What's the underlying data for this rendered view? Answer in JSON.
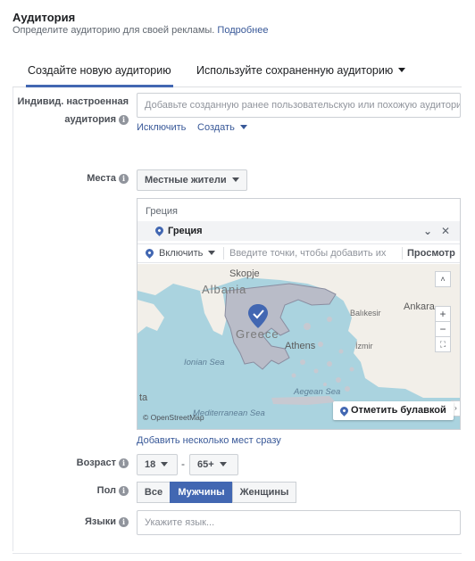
{
  "section": {
    "title": "Аудитория",
    "subtitle": "Определите аудиторию для своей рекламы.",
    "more_link": "Подробнее"
  },
  "tabs": [
    {
      "label": "Создайте новую аудиторию",
      "active": true
    },
    {
      "label": "Используйте сохраненную аудиторию",
      "active": false
    }
  ],
  "custom_audience": {
    "label_line1": "Индивид. настроенная",
    "label_line2": "аудитория",
    "placeholder": "Добавьте созданную ранее пользовательскую или похожую аудитори",
    "exclude_link": "Исключить",
    "create_link": "Создать"
  },
  "locations": {
    "label": "Места",
    "type_dropdown": "Местные жители",
    "query": "Греция",
    "selected": "Греция",
    "include_dropdown": "Включить",
    "input_placeholder": "Введите точки, чтобы добавить их",
    "browse_button": "Просмотр",
    "map": {
      "labels": {
        "skopje": "Skopje",
        "albania": "Albania",
        "greece": "Greece",
        "athens": "Athens",
        "izmir": "İzmir",
        "ankara": "Ankara",
        "balikesir": "Balıkesir",
        "ionian_sea": "Ionian Sea",
        "aegean_sea": "Aegean Sea",
        "mediterranean_sea": "Mediterranean Sea",
        "ta": "ta"
      },
      "attribution": "© OpenStreetMap",
      "drop_pin_button": "Отметить булавкой",
      "zoom_in": "+",
      "zoom_out": "−"
    },
    "add_many_link": "Добавить несколько мест сразу"
  },
  "age": {
    "label": "Возраст",
    "min": "18",
    "dash": "-",
    "max": "65+"
  },
  "gender": {
    "label": "Пол",
    "options": [
      "Все",
      "Мужчины",
      "Женщины"
    ],
    "selected": "Мужчины"
  },
  "languages": {
    "label": "Языки",
    "placeholder": "Укажите язык..."
  },
  "colors": {
    "accent": "#4267b2",
    "link": "#385898",
    "map_water": "#aad3df",
    "map_land": "#f2efe9",
    "selected_region": "#b9bcc8"
  }
}
